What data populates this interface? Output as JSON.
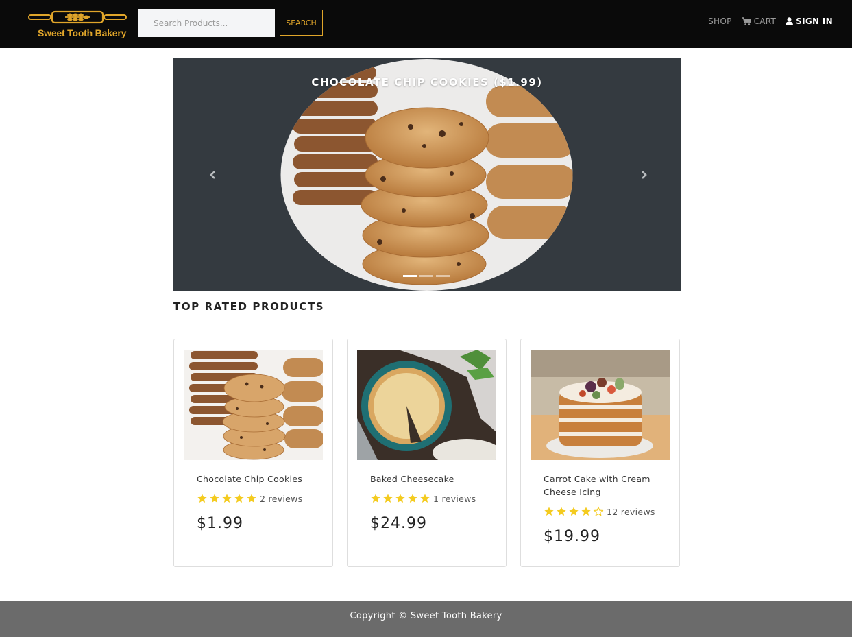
{
  "brand": {
    "name": "Sweet Tooth Bakery",
    "accent_color": "#e0a52a"
  },
  "search": {
    "placeholder": "Search Products...",
    "button_label": "SEARCH"
  },
  "nav": {
    "shop_label": "SHOP",
    "cart_label": "CART",
    "cart_icon": "shopping-cart-icon",
    "signin_label": "SIGN IN",
    "signin_icon": "user-icon"
  },
  "carousel": {
    "caption": "CHOCOLATE CHIP COOKIES ($1.99)",
    "prev_icon": "chevron-left-icon",
    "next_icon": "chevron-right-icon",
    "slide_count": 3,
    "active_slide": 0,
    "background": "#343a40"
  },
  "section": {
    "title": "TOP RATED PRODUCTS"
  },
  "products": [
    {
      "name": "Chocolate Chip Cookies",
      "rating": 5,
      "reviews": "2 reviews",
      "price": "$1.99",
      "image": "chocolate-chip-cookies-photo"
    },
    {
      "name": "Baked Cheesecake",
      "rating": 5,
      "reviews": "1 reviews",
      "price": "$24.99",
      "image": "baked-cheesecake-photo"
    },
    {
      "name": "Carrot Cake with Cream Cheese Icing",
      "rating": 4,
      "reviews": "12 reviews",
      "price": "$19.99",
      "image": "carrot-cake-photo"
    }
  ],
  "footer": {
    "text": "Copyright © Sweet Tooth Bakery",
    "background": "#6b6b6b"
  },
  "colors": {
    "navbar": "#0a0a0a",
    "star": "#f4cb1f"
  }
}
